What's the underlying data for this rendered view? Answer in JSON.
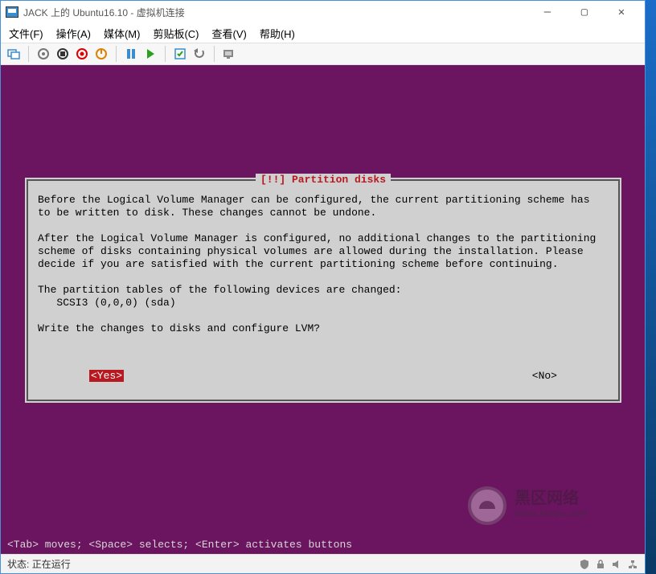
{
  "window": {
    "title": "JACK 上的 Ubuntu16.10 - 虚拟机连接"
  },
  "menu": {
    "file": "文件(F)",
    "action": "操作(A)",
    "media": "媒体(M)",
    "clipboard": "剪贴板(C)",
    "view": "查看(V)",
    "help": "帮助(H)"
  },
  "dialog": {
    "title": "[!!] Partition disks",
    "body": "Before the Logical Volume Manager can be configured, the current partitioning scheme has\nto be written to disk. These changes cannot be undone.\n\nAfter the Logical Volume Manager is configured, no additional changes to the partitioning\nscheme of disks containing physical volumes are allowed during the installation. Please\ndecide if you are satisfied with the current partitioning scheme before continuing.\n\nThe partition tables of the following devices are changed:\n   SCSI3 (0,0,0) (sda)\n\nWrite the changes to disks and configure LVM?",
    "yes": "<Yes>",
    "no": "<No>"
  },
  "footer_hint": "<Tab> moves; <Space> selects; <Enter> activates buttons",
  "status": {
    "label": "状态:",
    "value": "正在运行"
  },
  "watermark": {
    "line1": "黑区网络",
    "line2": "www.heiqu.com"
  }
}
